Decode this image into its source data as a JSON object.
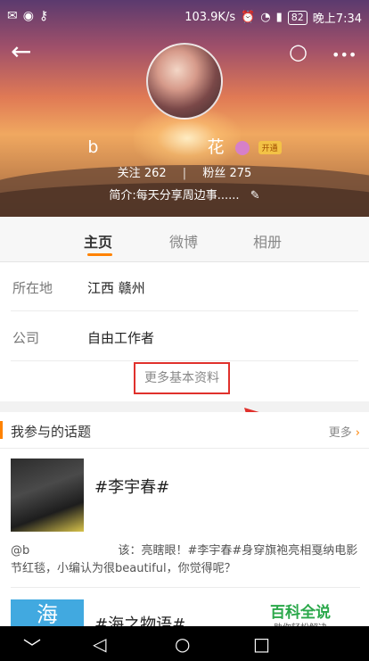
{
  "status_bar": {
    "left_icons": [
      "notification-icon",
      "weibo-icon",
      "key-icon"
    ],
    "speed": "103.9K/s",
    "battery": "82",
    "time": "晚上7:34"
  },
  "header": {
    "back_icon": "←",
    "search_icon": "○",
    "more_icon": "•••"
  },
  "profile": {
    "username": "b",
    "username_tail": "花",
    "vip_label": "开通",
    "follow_label": "关注",
    "follow_count": "262",
    "fans_label": "粉丝",
    "fans_count": "275",
    "intro": "简介:每天分享周边事......",
    "edit_icon": "✎"
  },
  "tabs": [
    {
      "label": "主页",
      "active": true
    },
    {
      "label": "微博",
      "active": false
    },
    {
      "label": "相册",
      "active": false
    }
  ],
  "info": {
    "rows": [
      {
        "key": "所在地",
        "value": "江西 赣州"
      },
      {
        "key": "公司",
        "value": "自由工作者"
      }
    ],
    "more_link": "更多基本资料"
  },
  "topics": {
    "title": "我参与的话题",
    "more": "更多",
    "more_chevron": "›",
    "items": [
      {
        "title": "#李宇春#",
        "desc": "@b 　　　　　　　 该：亮瞎眼！#李宇春#身穿旗袍亮相戛纳电影节红毯，小编认为很beautiful，你觉得呢？",
        "thumb_text": ""
      },
      {
        "title": "#海之物语#",
        "thumb_text": "海"
      }
    ]
  },
  "watermark": {
    "main": "百科全说",
    "sub": "助你轻松解决"
  },
  "nav": {
    "down": "﹀",
    "back": "◁",
    "home": "○",
    "recent": "□"
  },
  "colors": {
    "accent": "#ff8200",
    "highlight_box": "#e0312c"
  }
}
